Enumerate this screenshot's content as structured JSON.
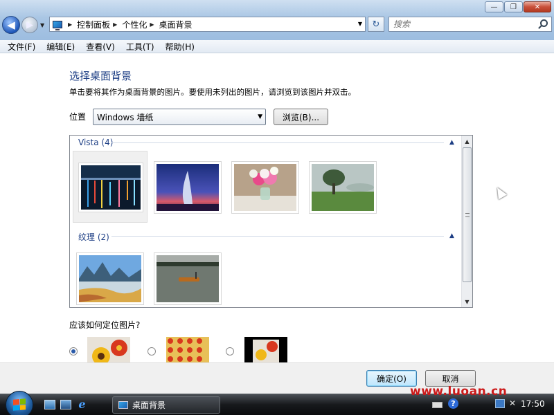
{
  "window": {
    "caption_buttons": [
      "minimize",
      "maximize",
      "close"
    ],
    "close_glyph": "✕"
  },
  "navigation": {
    "back_glyph": "◀",
    "forward_glyph": "▶"
  },
  "address_bar": {
    "breadcrumbs": [
      "控制面板",
      "个性化",
      "桌面背景"
    ],
    "separator_glyph": "▶",
    "dropdown_glyph": "▼"
  },
  "refresh_glyph": "↻",
  "search": {
    "placeholder": "搜索"
  },
  "menu": [
    "文件(F)",
    "编辑(E)",
    "查看(V)",
    "工具(T)",
    "帮助(H)"
  ],
  "page": {
    "title": "选择桌面背景",
    "description": "单击要将其作为桌面背景的图片。要使用未列出的图片，请浏览到该图片并双击。",
    "location_label": "位置",
    "location_value": "Windows 墙纸",
    "browse_label": "浏览(B)..."
  },
  "gallery": {
    "groups": [
      {
        "name": "Vista (4)",
        "collapse_glyph": "▲",
        "images": [
          "city-lights-harbor",
          "burj-al-arab-sunset",
          "flower-bouquet",
          "tree-in-meadow"
        ],
        "selected_index": 0
      },
      {
        "name": "纹理 (2)",
        "collapse_glyph": "▲",
        "images": [
          "guilin-river-mountains",
          "boat-on-lake"
        ]
      }
    ]
  },
  "position": {
    "question": "应该如何定位图片?",
    "options": [
      "fill-screen",
      "tile",
      "center"
    ],
    "selected_index": 0
  },
  "buttons": {
    "ok": "确定(O)",
    "cancel": "取消"
  },
  "taskbar": {
    "task_label": "桌面背景",
    "clock": "17:50",
    "watermark_url": "www.luoan.cn"
  }
}
